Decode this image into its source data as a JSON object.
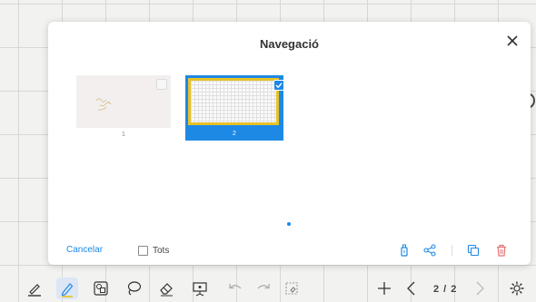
{
  "dialog": {
    "title": "Navegació",
    "thumbnails": [
      {
        "number": "1",
        "selected": false
      },
      {
        "number": "2",
        "selected": true
      }
    ],
    "footer": {
      "cancel_label": "Cancelar",
      "select_all_label": "Tots"
    },
    "accent_color": "#1e88e5"
  },
  "toolbar": {
    "tools": [
      {
        "icon": "pen-icon"
      },
      {
        "icon": "pencil-icon",
        "active": true
      },
      {
        "icon": "shapes-icon"
      },
      {
        "icon": "lasso-icon"
      },
      {
        "icon": "eraser-icon"
      },
      {
        "icon": "presentation-icon"
      },
      {
        "icon": "undo-icon"
      },
      {
        "icon": "redo-icon"
      },
      {
        "icon": "clear-page-icon"
      }
    ],
    "page_indicator": "2 / 2"
  }
}
